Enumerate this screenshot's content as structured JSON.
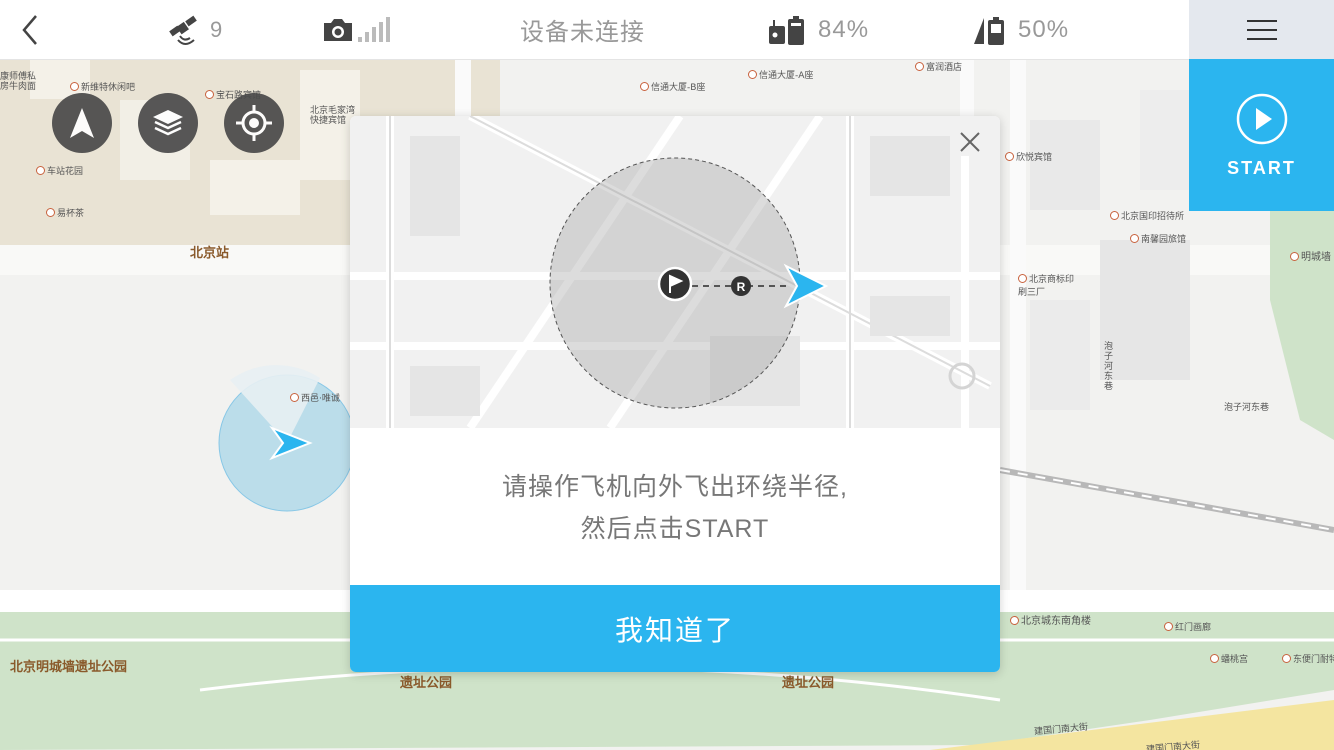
{
  "status_bar": {
    "satellite_count": "9",
    "connection_status": "设备未连接",
    "remote_battery": "84%",
    "aircraft_battery": "50%"
  },
  "start_button": {
    "label": "START"
  },
  "map": {
    "pois": [
      "北京站",
      "信通大厦-B座",
      "信通大厦-A座",
      "富润酒店",
      "欣悦宾馆",
      "北京国印招待所",
      "南馨园旅馆",
      "明城墙",
      "北京商标印刷三厂",
      "泡子河东巷",
      "泡子河东巷",
      "北京城东南角楼",
      "红门画廊",
      "蟠桃宫",
      "东便门耐特",
      "康师傅私房牛肉面",
      "新维特休闲吧",
      "宝石路宾馆",
      "北京毛家湾快捷宾馆",
      "车站花园",
      "易杯茶",
      "西邑·唯诚",
      "建国门南大街",
      "建国门南大街"
    ],
    "parks": [
      "北京明城墙遗址公园",
      "遗址公园",
      "遗址公园"
    ]
  },
  "dialog": {
    "message_line1": "请操作飞机向外飞出环绕半径,",
    "message_line2": "然后点击START",
    "confirm_label": "我知道了"
  },
  "icons": {
    "back": "chevron-left-icon",
    "satellite": "satellite-icon",
    "camera": "camera-icon",
    "signal": "signal-bars-icon",
    "remote": "remote-controller-icon",
    "aircraft_battery": "aircraft-battery-icon",
    "menu": "hamburger-menu-icon",
    "start": "play-circle-icon",
    "compass": "compass-arrow-icon",
    "layers": "layers-icon",
    "locate": "locate-crosshair-icon",
    "close": "close-icon"
  },
  "colors": {
    "accent": "#2bb5ef",
    "topbar": "#ffffff",
    "tool_button": "#4a4a4a"
  }
}
